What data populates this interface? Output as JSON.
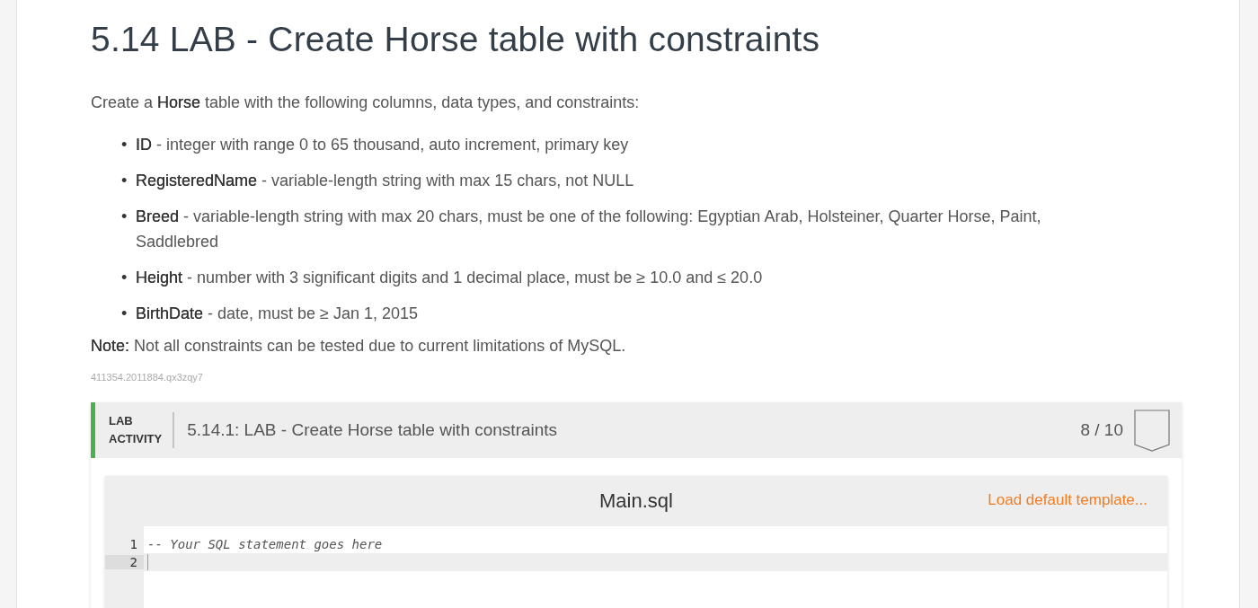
{
  "title": "5.14 LAB - Create Horse table with constraints",
  "intro": "Create a **Horse** table with the following columns, data types, and constraints:",
  "bullets": [
    {
      "marker": "•",
      "text": "**ID** - integer with range 0 to 65 thousand, auto increment, primary key"
    },
    {
      "marker": "•",
      "text": "**RegisteredName** - variable-length string with max 15 chars, not NULL"
    },
    {
      "marker": "•",
      "text": "**Breed** - variable-length string with max 20 chars, must be one of the following: Egyptian Arab, Holsteiner, Quarter Horse, Paint, Saddlebred"
    },
    {
      "marker": "•",
      "text": "**Height** - number with 3 significant digits and 1 decimal place, must be ≥ 10.0 and ≤ 20.0"
    },
    {
      "marker": "•",
      "text": "**BirthDate** - date, must be ≥ Jan 1, 2015"
    }
  ],
  "note": "**Note:** Not all constraints can be tested due to current limitations of MySQL.",
  "code_id": "411354.2011884.qx3zqy7",
  "activity": {
    "label_lines": [
      "LAB",
      "ACTIVITY"
    ],
    "title": "5.14.1: LAB - Create Horse table with constraints",
    "score": "8 / 10"
  },
  "editor": {
    "filename": "Main.sql",
    "load_link": "Load default template...",
    "lines": [
      {
        "number": "1",
        "text": "-- Your SQL statement goes here",
        "selected": false
      },
      {
        "number": "2",
        "selected": true
      }
    ]
  }
}
